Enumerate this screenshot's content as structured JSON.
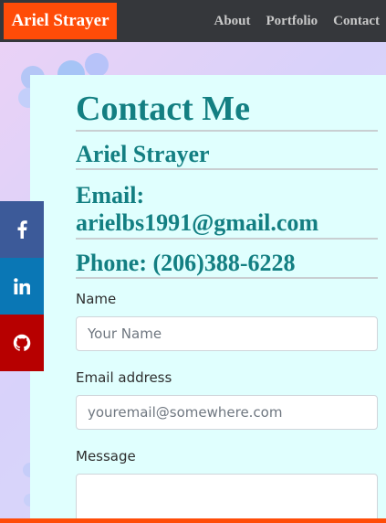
{
  "navbar": {
    "brand": "Ariel Strayer",
    "links": [
      {
        "label": "About"
      },
      {
        "label": "Portfolio"
      },
      {
        "label": "Contact"
      }
    ]
  },
  "social": [
    {
      "name": "facebook",
      "icon": "facebook-icon",
      "color": "#3c5a99"
    },
    {
      "name": "linkedin",
      "icon": "linkedin-icon",
      "color": "#0a77b5"
    },
    {
      "name": "github",
      "icon": "github-icon",
      "color": "#b70000"
    }
  ],
  "contact": {
    "title": "Contact Me",
    "name": "Ariel Strayer",
    "email_line1": "Email:",
    "email_line2": "arielbs1991@gmail.com",
    "phone": "Phone: (206)388-6228"
  },
  "form": {
    "name_label": "Name",
    "name_placeholder": "Your Name",
    "email_label": "Email address",
    "email_placeholder": "youremail@somewhere.com",
    "message_label": "Message",
    "message_placeholder": ""
  },
  "colors": {
    "accent": "#ff4c08",
    "heading": "#137f82",
    "navbar": "#35373b",
    "card": "#e0fffe"
  }
}
